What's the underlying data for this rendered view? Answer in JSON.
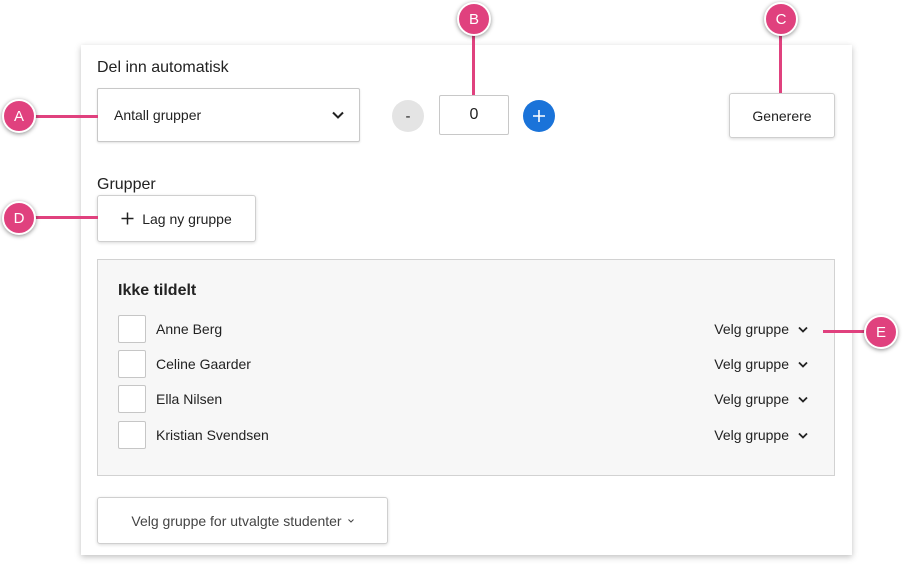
{
  "auto_section": {
    "label": "Del inn automatisk",
    "select_value": "Antall grupper",
    "minus_label": "-",
    "count_value": "0",
    "plus_label": "+",
    "generate_label": "Generere"
  },
  "groups_section": {
    "label": "Grupper",
    "new_group_label": "Lag ny gruppe"
  },
  "unassigned": {
    "title": "Ikke tildelt",
    "students": [
      {
        "name": "Anne Berg",
        "group_select": "Velg gruppe"
      },
      {
        "name": "Celine Gaarder",
        "group_select": "Velg gruppe"
      },
      {
        "name": "Ella Nilsen",
        "group_select": "Velg gruppe"
      },
      {
        "name": "Kristian Svendsen",
        "group_select": "Velg gruppe"
      }
    ]
  },
  "bulk_select_label": "Velg gruppe for utvalgte studenter",
  "callouts": [
    "A",
    "B",
    "C",
    "D",
    "E"
  ],
  "colors": {
    "accent": "#1a73d9",
    "callout": "#e0417e"
  }
}
